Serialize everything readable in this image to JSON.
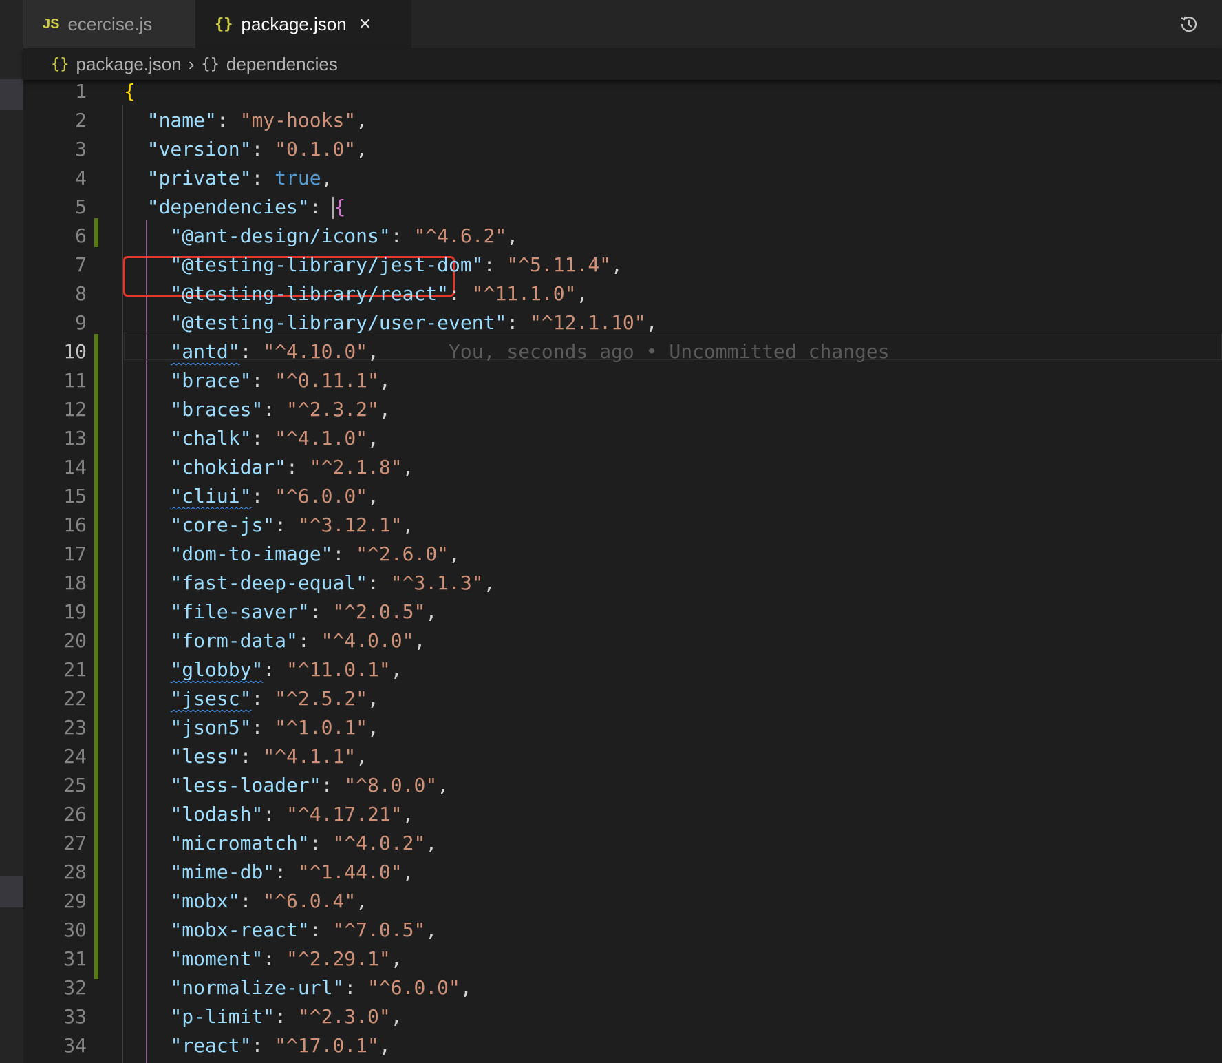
{
  "tabs": [
    {
      "label": "ecercise.js",
      "icon": "JS",
      "active": false
    },
    {
      "label": "package.json",
      "icon": "{}",
      "active": true
    }
  ],
  "breadcrumb": {
    "file": "package.json",
    "symbol": "dependencies"
  },
  "blame_annotation": "You, seconds ago • Uncommitted changes",
  "current_line": 10,
  "lines": [
    {
      "n": "1",
      "k": "",
      "v": "",
      "open": "{"
    },
    {
      "n": "2",
      "k": "name",
      "v": "my-hooks"
    },
    {
      "n": "3",
      "k": "version",
      "v": "0.1.0"
    },
    {
      "n": "4",
      "k": "private",
      "v": "true"
    },
    {
      "n": "5",
      "k": "dependencies",
      "v": "{"
    },
    {
      "n": "6",
      "k": "@ant-design/icons",
      "v": "^4.6.2"
    },
    {
      "n": "7",
      "k": "@testing-library/jest-dom",
      "v": "^5.11.4"
    },
    {
      "n": "8",
      "k": "@testing-library/react",
      "v": "^11.1.0"
    },
    {
      "n": "9",
      "k": "@testing-library/user-event",
      "v": "^12.1.10"
    },
    {
      "n": "10",
      "k": "antd",
      "v": "^4.10.0"
    },
    {
      "n": "11",
      "k": "brace",
      "v": "^0.11.1"
    },
    {
      "n": "12",
      "k": "braces",
      "v": "^2.3.2"
    },
    {
      "n": "13",
      "k": "chalk",
      "v": "^4.1.0"
    },
    {
      "n": "14",
      "k": "chokidar",
      "v": "^2.1.8"
    },
    {
      "n": "15",
      "k": "cliui",
      "v": "^6.0.0"
    },
    {
      "n": "16",
      "k": "core-js",
      "v": "^3.12.1"
    },
    {
      "n": "17",
      "k": "dom-to-image",
      "v": "^2.6.0"
    },
    {
      "n": "18",
      "k": "fast-deep-equal",
      "v": "^3.1.3"
    },
    {
      "n": "19",
      "k": "file-saver",
      "v": "^2.0.5"
    },
    {
      "n": "20",
      "k": "form-data",
      "v": "^4.0.0"
    },
    {
      "n": "21",
      "k": "globby",
      "v": "^11.0.1"
    },
    {
      "n": "22",
      "k": "jsesc",
      "v": "^2.5.2"
    },
    {
      "n": "23",
      "k": "json5",
      "v": "^1.0.1"
    },
    {
      "n": "24",
      "k": "less",
      "v": "^4.1.1"
    },
    {
      "n": "25",
      "k": "less-loader",
      "v": "^8.0.0"
    },
    {
      "n": "26",
      "k": "lodash",
      "v": "^4.17.21"
    },
    {
      "n": "27",
      "k": "micromatch",
      "v": "^4.0.2"
    },
    {
      "n": "28",
      "k": "mime-db",
      "v": "^1.44.0"
    },
    {
      "n": "29",
      "k": "mobx",
      "v": "^6.0.4"
    },
    {
      "n": "30",
      "k": "mobx-react",
      "v": "^7.0.5"
    },
    {
      "n": "31",
      "k": "moment",
      "v": "^2.29.1"
    },
    {
      "n": "32",
      "k": "normalize-url",
      "v": "^6.0.0"
    },
    {
      "n": "33",
      "k": "p-limit",
      "v": "^2.3.0"
    },
    {
      "n": "34",
      "k": "react",
      "v": "^17.0.1"
    }
  ],
  "colors": {
    "key": "#9cdcfe",
    "string": "#ce9178",
    "keyword": "#569cd6",
    "highlight": "#e2372b",
    "modified": "#587c0c"
  }
}
